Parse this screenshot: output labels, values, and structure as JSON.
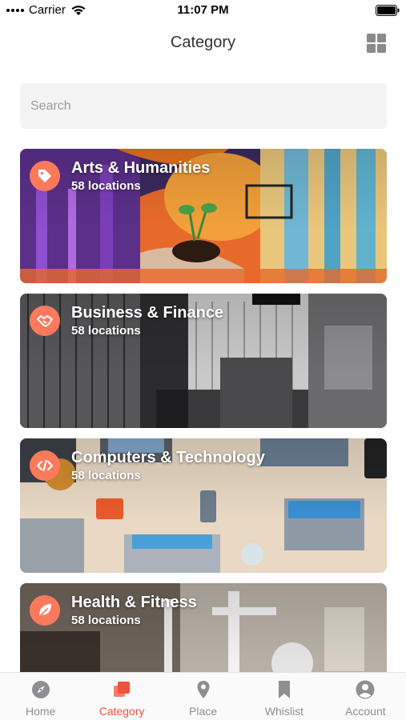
{
  "status_bar": {
    "carrier": "Carrier",
    "time": "11:07 PM"
  },
  "nav": {
    "title": "Category"
  },
  "search": {
    "placeholder": "Search"
  },
  "categories": [
    {
      "title": "Arts & Humanities",
      "subtitle": "58 locations",
      "icon": "tag-icon"
    },
    {
      "title": "Business & Finance",
      "subtitle": "58 locations",
      "icon": "handshake-icon"
    },
    {
      "title": "Computers & Technology",
      "subtitle": "58 locations",
      "icon": "code-icon"
    },
    {
      "title": "Health & Fitness",
      "subtitle": "58 locations",
      "icon": "leaf-icon"
    }
  ],
  "tabs": [
    {
      "label": "Home",
      "icon": "compass-icon",
      "active": false
    },
    {
      "label": "Category",
      "icon": "category-icon",
      "active": true
    },
    {
      "label": "Place",
      "icon": "location-pin-icon",
      "active": false
    },
    {
      "label": "Whislist",
      "icon": "bookmark-icon",
      "active": false
    },
    {
      "label": "Account",
      "icon": "account-icon",
      "active": false
    }
  ],
  "colors": {
    "accent": "#f0533b",
    "icon_badge": "#ff7a5c",
    "tab_inactive": "#8e8e93"
  }
}
